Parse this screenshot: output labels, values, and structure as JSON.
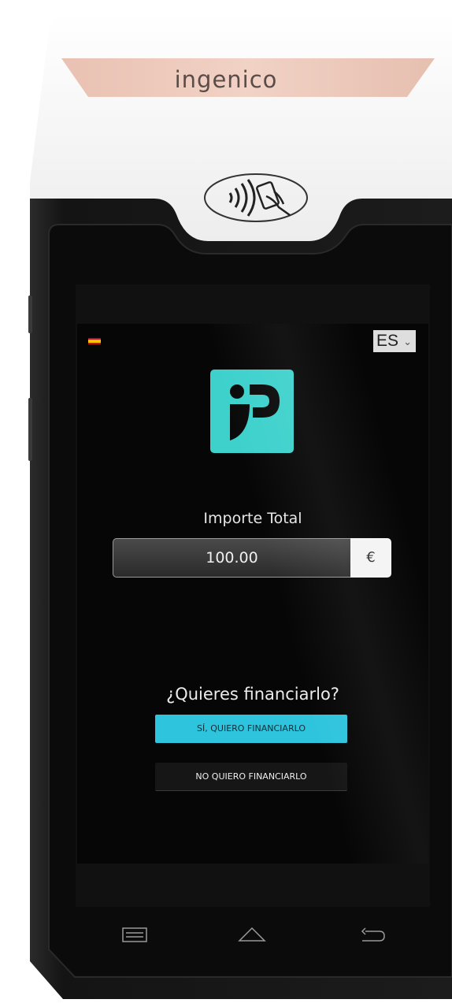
{
  "device": {
    "brand": "ingenico"
  },
  "screen": {
    "language": {
      "selected": "ES",
      "flag_icon": "spain-flag-icon"
    },
    "logo_icon": "app-logo-icon",
    "total_label": "Importe Total",
    "amount_value": "100.00",
    "currency_symbol": "€",
    "question": "¿Quieres financiarlo?",
    "yes_button_label": "SÍ, QUIERO FINANCIARLO",
    "no_button_label": "NO QUIERO FINANCIARLO"
  },
  "navbar": {
    "menu_icon": "menu-icon",
    "home_icon": "home-icon",
    "back_icon": "back-icon"
  },
  "colors": {
    "accent_teal": "#3ed1cc",
    "button_cyan": "#2fc4dd",
    "brand_stripe": "#ecc7b9"
  }
}
